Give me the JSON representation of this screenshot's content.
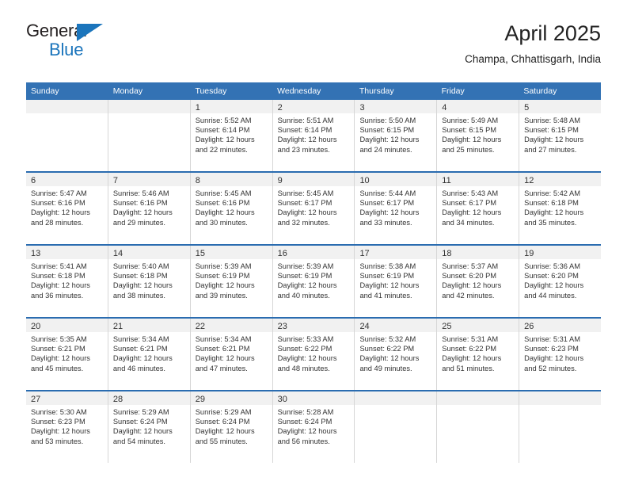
{
  "brand": {
    "name_primary": "General",
    "name_secondary": "Blue",
    "triangle_color": "#1b75bc"
  },
  "header": {
    "title": "April 2025",
    "subtitle": "Champa, Chhattisgarh, India"
  },
  "theme": {
    "header_blue": "#3372b4",
    "row_divider_blue": "#2a6cb0",
    "date_strip_gray": "#f1f1f1",
    "cell_border_gray": "#d6d6d6",
    "text_color": "#333333"
  },
  "calendar": {
    "weekday_headers": [
      "Sunday",
      "Monday",
      "Tuesday",
      "Wednesday",
      "Thursday",
      "Friday",
      "Saturday"
    ],
    "weeks": [
      [
        {
          "day": "",
          "sunrise": "",
          "sunset": "",
          "daylight_1": "",
          "daylight_2": ""
        },
        {
          "day": "",
          "sunrise": "",
          "sunset": "",
          "daylight_1": "",
          "daylight_2": ""
        },
        {
          "day": "1",
          "sunrise": "Sunrise: 5:52 AM",
          "sunset": "Sunset: 6:14 PM",
          "daylight_1": "Daylight: 12 hours",
          "daylight_2": "and 22 minutes."
        },
        {
          "day": "2",
          "sunrise": "Sunrise: 5:51 AM",
          "sunset": "Sunset: 6:14 PM",
          "daylight_1": "Daylight: 12 hours",
          "daylight_2": "and 23 minutes."
        },
        {
          "day": "3",
          "sunrise": "Sunrise: 5:50 AM",
          "sunset": "Sunset: 6:15 PM",
          "daylight_1": "Daylight: 12 hours",
          "daylight_2": "and 24 minutes."
        },
        {
          "day": "4",
          "sunrise": "Sunrise: 5:49 AM",
          "sunset": "Sunset: 6:15 PM",
          "daylight_1": "Daylight: 12 hours",
          "daylight_2": "and 25 minutes."
        },
        {
          "day": "5",
          "sunrise": "Sunrise: 5:48 AM",
          "sunset": "Sunset: 6:15 PM",
          "daylight_1": "Daylight: 12 hours",
          "daylight_2": "and 27 minutes."
        }
      ],
      [
        {
          "day": "6",
          "sunrise": "Sunrise: 5:47 AM",
          "sunset": "Sunset: 6:16 PM",
          "daylight_1": "Daylight: 12 hours",
          "daylight_2": "and 28 minutes."
        },
        {
          "day": "7",
          "sunrise": "Sunrise: 5:46 AM",
          "sunset": "Sunset: 6:16 PM",
          "daylight_1": "Daylight: 12 hours",
          "daylight_2": "and 29 minutes."
        },
        {
          "day": "8",
          "sunrise": "Sunrise: 5:45 AM",
          "sunset": "Sunset: 6:16 PM",
          "daylight_1": "Daylight: 12 hours",
          "daylight_2": "and 30 minutes."
        },
        {
          "day": "9",
          "sunrise": "Sunrise: 5:45 AM",
          "sunset": "Sunset: 6:17 PM",
          "daylight_1": "Daylight: 12 hours",
          "daylight_2": "and 32 minutes."
        },
        {
          "day": "10",
          "sunrise": "Sunrise: 5:44 AM",
          "sunset": "Sunset: 6:17 PM",
          "daylight_1": "Daylight: 12 hours",
          "daylight_2": "and 33 minutes."
        },
        {
          "day": "11",
          "sunrise": "Sunrise: 5:43 AM",
          "sunset": "Sunset: 6:17 PM",
          "daylight_1": "Daylight: 12 hours",
          "daylight_2": "and 34 minutes."
        },
        {
          "day": "12",
          "sunrise": "Sunrise: 5:42 AM",
          "sunset": "Sunset: 6:18 PM",
          "daylight_1": "Daylight: 12 hours",
          "daylight_2": "and 35 minutes."
        }
      ],
      [
        {
          "day": "13",
          "sunrise": "Sunrise: 5:41 AM",
          "sunset": "Sunset: 6:18 PM",
          "daylight_1": "Daylight: 12 hours",
          "daylight_2": "and 36 minutes."
        },
        {
          "day": "14",
          "sunrise": "Sunrise: 5:40 AM",
          "sunset": "Sunset: 6:18 PM",
          "daylight_1": "Daylight: 12 hours",
          "daylight_2": "and 38 minutes."
        },
        {
          "day": "15",
          "sunrise": "Sunrise: 5:39 AM",
          "sunset": "Sunset: 6:19 PM",
          "daylight_1": "Daylight: 12 hours",
          "daylight_2": "and 39 minutes."
        },
        {
          "day": "16",
          "sunrise": "Sunrise: 5:39 AM",
          "sunset": "Sunset: 6:19 PM",
          "daylight_1": "Daylight: 12 hours",
          "daylight_2": "and 40 minutes."
        },
        {
          "day": "17",
          "sunrise": "Sunrise: 5:38 AM",
          "sunset": "Sunset: 6:19 PM",
          "daylight_1": "Daylight: 12 hours",
          "daylight_2": "and 41 minutes."
        },
        {
          "day": "18",
          "sunrise": "Sunrise: 5:37 AM",
          "sunset": "Sunset: 6:20 PM",
          "daylight_1": "Daylight: 12 hours",
          "daylight_2": "and 42 minutes."
        },
        {
          "day": "19",
          "sunrise": "Sunrise: 5:36 AM",
          "sunset": "Sunset: 6:20 PM",
          "daylight_1": "Daylight: 12 hours",
          "daylight_2": "and 44 minutes."
        }
      ],
      [
        {
          "day": "20",
          "sunrise": "Sunrise: 5:35 AM",
          "sunset": "Sunset: 6:21 PM",
          "daylight_1": "Daylight: 12 hours",
          "daylight_2": "and 45 minutes."
        },
        {
          "day": "21",
          "sunrise": "Sunrise: 5:34 AM",
          "sunset": "Sunset: 6:21 PM",
          "daylight_1": "Daylight: 12 hours",
          "daylight_2": "and 46 minutes."
        },
        {
          "day": "22",
          "sunrise": "Sunrise: 5:34 AM",
          "sunset": "Sunset: 6:21 PM",
          "daylight_1": "Daylight: 12 hours",
          "daylight_2": "and 47 minutes."
        },
        {
          "day": "23",
          "sunrise": "Sunrise: 5:33 AM",
          "sunset": "Sunset: 6:22 PM",
          "daylight_1": "Daylight: 12 hours",
          "daylight_2": "and 48 minutes."
        },
        {
          "day": "24",
          "sunrise": "Sunrise: 5:32 AM",
          "sunset": "Sunset: 6:22 PM",
          "daylight_1": "Daylight: 12 hours",
          "daylight_2": "and 49 minutes."
        },
        {
          "day": "25",
          "sunrise": "Sunrise: 5:31 AM",
          "sunset": "Sunset: 6:22 PM",
          "daylight_1": "Daylight: 12 hours",
          "daylight_2": "and 51 minutes."
        },
        {
          "day": "26",
          "sunrise": "Sunrise: 5:31 AM",
          "sunset": "Sunset: 6:23 PM",
          "daylight_1": "Daylight: 12 hours",
          "daylight_2": "and 52 minutes."
        }
      ],
      [
        {
          "day": "27",
          "sunrise": "Sunrise: 5:30 AM",
          "sunset": "Sunset: 6:23 PM",
          "daylight_1": "Daylight: 12 hours",
          "daylight_2": "and 53 minutes."
        },
        {
          "day": "28",
          "sunrise": "Sunrise: 5:29 AM",
          "sunset": "Sunset: 6:24 PM",
          "daylight_1": "Daylight: 12 hours",
          "daylight_2": "and 54 minutes."
        },
        {
          "day": "29",
          "sunrise": "Sunrise: 5:29 AM",
          "sunset": "Sunset: 6:24 PM",
          "daylight_1": "Daylight: 12 hours",
          "daylight_2": "and 55 minutes."
        },
        {
          "day": "30",
          "sunrise": "Sunrise: 5:28 AM",
          "sunset": "Sunset: 6:24 PM",
          "daylight_1": "Daylight: 12 hours",
          "daylight_2": "and 56 minutes."
        },
        {
          "day": "",
          "sunrise": "",
          "sunset": "",
          "daylight_1": "",
          "daylight_2": ""
        },
        {
          "day": "",
          "sunrise": "",
          "sunset": "",
          "daylight_1": "",
          "daylight_2": ""
        },
        {
          "day": "",
          "sunrise": "",
          "sunset": "",
          "daylight_1": "",
          "daylight_2": ""
        }
      ]
    ]
  }
}
